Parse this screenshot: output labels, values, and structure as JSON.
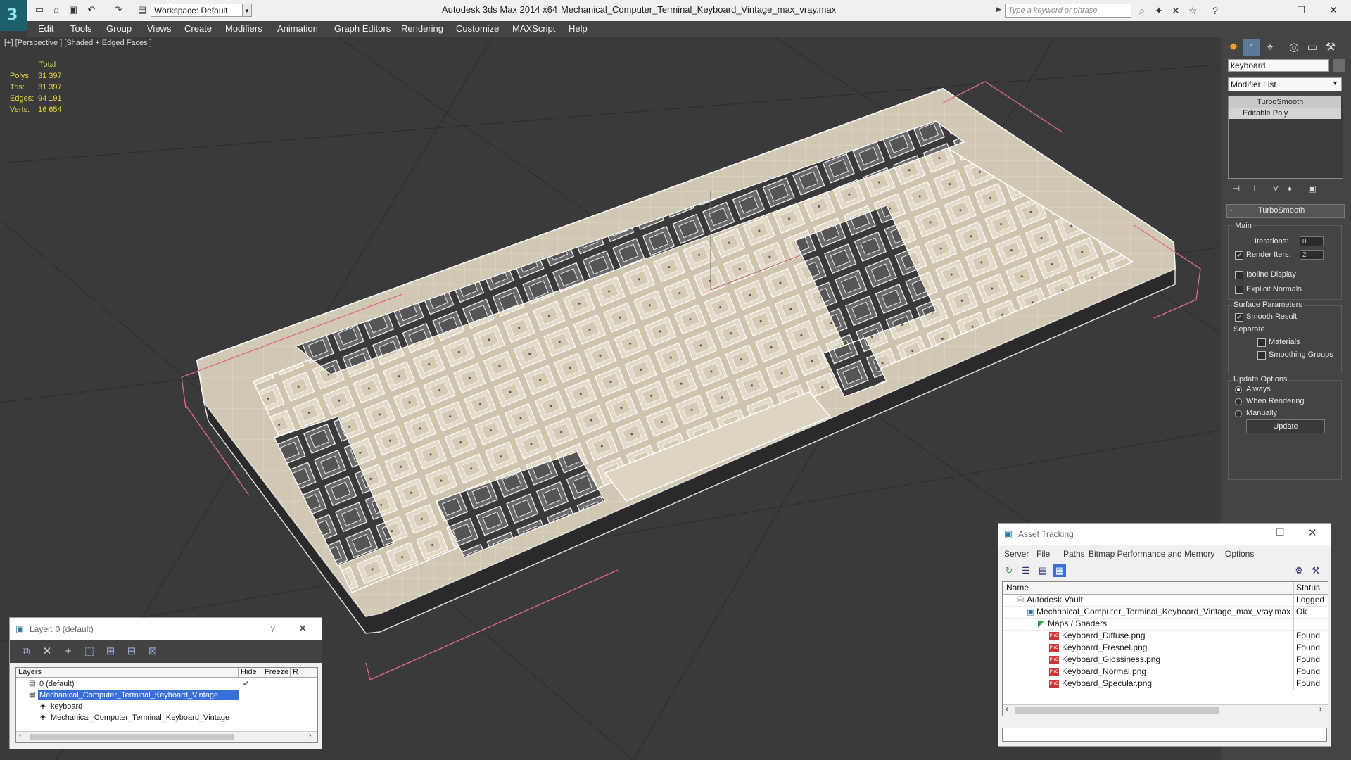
{
  "titlebar": {
    "workspace": "Workspace: Default",
    "app_title": "Autodesk 3ds Max  2014 x64",
    "doc_title": "Mechanical_Computer_Terminal_Keyboard_Vintage_max_vray.max",
    "search_placeholder": "Type a keyword or phrase"
  },
  "menu": [
    "Edit",
    "Tools",
    "Group",
    "Views",
    "Create",
    "Modifiers",
    "Animation",
    "Graph Editors",
    "Rendering",
    "Customize",
    "MAXScript",
    "Help"
  ],
  "viewport": {
    "label": "[+] [Perspective ] [Shaded + Edged Faces ]",
    "stats_header": "Total",
    "stats": [
      {
        "label": "Polys:",
        "value": "31 397"
      },
      {
        "label": "Tris:",
        "value": "31 397"
      },
      {
        "label": "Edges:",
        "value": "94 191"
      },
      {
        "label": "Verts:",
        "value": "16 654"
      }
    ]
  },
  "command_panel": {
    "object_name": "keyboard",
    "modifier_list": "Modifier List",
    "stack": [
      "TurboSmooth",
      "Editable Poly"
    ],
    "rollout_title": "TurboSmooth",
    "main_label": "Main",
    "iterations_label": "Iterations:",
    "iterations_value": "0",
    "render_iters_label": "Render Iters:",
    "render_iters_value": "2",
    "isoline_label": "Isoline Display",
    "explicit_label": "Explicit Normals",
    "surface_label": "Surface Parameters",
    "smooth_result_label": "Smooth Result",
    "separate_label": "Separate",
    "materials_label": "Materials",
    "smoothing_groups_label": "Smoothing Groups",
    "update_options_label": "Update Options",
    "always_label": "Always",
    "when_rendering_label": "When Rendering",
    "manually_label": "Manually",
    "update_button": "Update"
  },
  "layer_dialog": {
    "title": "Layer: 0 (default)",
    "help": "?",
    "col_layers": "Layers",
    "col_hide": "Hide",
    "col_freeze": "Freeze",
    "col_r": "R",
    "rows": [
      {
        "name": "0 (default)",
        "indent": 0,
        "selected": false
      },
      {
        "name": "Mechanical_Computer_Terminal_Keyboard_Vintage",
        "indent": 0,
        "selected": true
      },
      {
        "name": "keyboard",
        "indent": 1,
        "selected": false
      },
      {
        "name": "Mechanical_Computer_Terminal_Keyboard_Vintage",
        "indent": 1,
        "selected": false
      }
    ]
  },
  "asset_tracking": {
    "title": "Asset Tracking",
    "menu": [
      "Server",
      "File",
      "Paths",
      "Bitmap Performance and Memory",
      "Options"
    ],
    "col_name": "Name",
    "col_status": "Status",
    "rows": [
      {
        "name": "Autodesk Vault",
        "status": "Logged O",
        "indent": 0,
        "type": "vault"
      },
      {
        "name": "Mechanical_Computer_Terminal_Keyboard_Vintage_max_vray.max",
        "status": "Ok",
        "indent": 1,
        "type": "max"
      },
      {
        "name": "Maps / Shaders",
        "status": "",
        "indent": 2,
        "type": "folder"
      },
      {
        "name": "Keyboard_Diffuse.png",
        "status": "Found",
        "indent": 3,
        "type": "png"
      },
      {
        "name": "Keyboard_Fresnel.png",
        "status": "Found",
        "indent": 3,
        "type": "png"
      },
      {
        "name": "Keyboard_Glossiness.png",
        "status": "Found",
        "indent": 3,
        "type": "png"
      },
      {
        "name": "Keyboard_Normal.png",
        "status": "Found",
        "indent": 3,
        "type": "png"
      },
      {
        "name": "Keyboard_Specular.png",
        "status": "Found",
        "indent": 3,
        "type": "png"
      }
    ]
  }
}
